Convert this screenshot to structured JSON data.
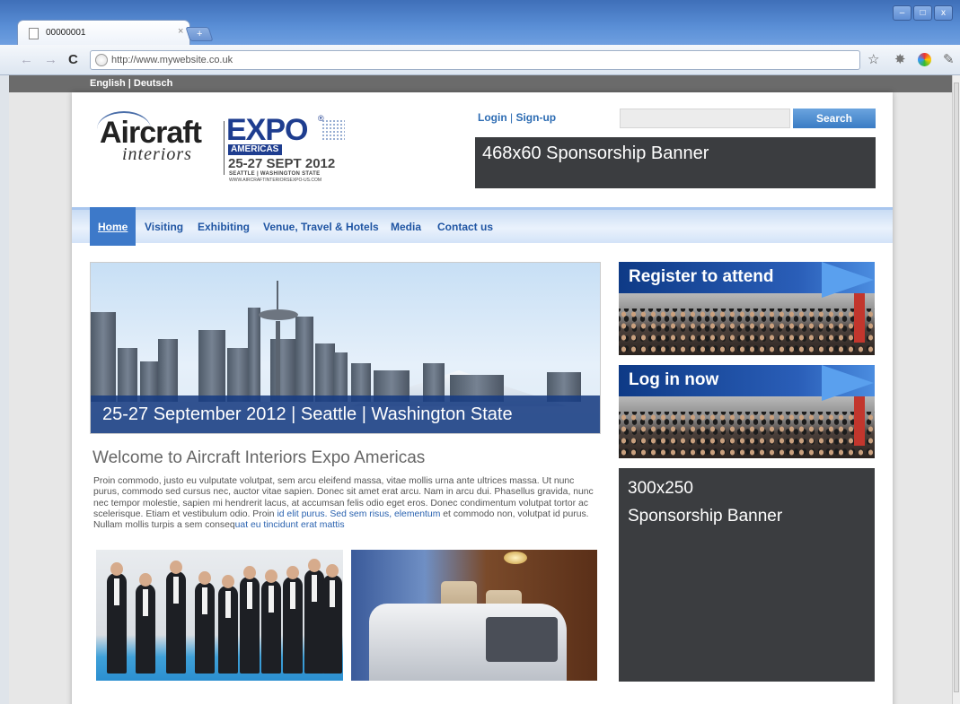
{
  "browser": {
    "tab_title": "00000001",
    "tab_close": "×",
    "new_tab": "+",
    "url": "http://www.mywebsite.co.uk",
    "window_controls": [
      "–",
      "□",
      "x"
    ]
  },
  "lang_bar": "English | Deutsch",
  "logo": {
    "line1": "Aircraft",
    "line2": "interiors",
    "expo": "EXPO",
    "reg_mark": "®",
    "region": "AMERICAS",
    "dates": "25-27 SEPT 2012",
    "location": "SEATTLE | WASHINGTON STATE",
    "website": "WWW.AIRCRAFTINTERIORSEXPO-US.COM"
  },
  "header": {
    "login": "Login",
    "separator": "|",
    "signup": "Sign-up",
    "search_placeholder": "",
    "search_button": "Search",
    "top_banner": "468x60 Sponsorship Banner"
  },
  "nav": {
    "items": [
      "Home",
      "Visiting",
      "Exhibiting",
      "Venue, Travel & Hotels",
      "Media",
      "Contact us"
    ],
    "active": "Home"
  },
  "hero": {
    "caption": "25-27 September 2012 | Seattle | Washington State"
  },
  "welcome": {
    "title": "Welcome to Aircraft Interiors Expo Americas",
    "body_start": "Proin commodo, justo eu vulputate volutpat, sem arcu eleifend massa, vitae mollis urna ante ultrices massa. Ut nunc purus, commodo sed cursus nec, auctor vitae sapien. Donec sit amet erat arcu. Nam in arcu dui. Phasellus gravida, nunc nec tempor molestie, sapien mi hendrerit lacus, at accumsan felis odio eget eros. Donec condimentum volutpat tortor ac scelerisque. Etiam et vestibulum odio. Proin ",
    "body_link1": "id elit purus. Sed sem risus, elementum",
    "body_mid": " et commodo non, volutpat id purus. Nullam mollis turpis a sem conseq",
    "body_link2": "uat eu tincidunt erat mattis"
  },
  "sidebar": {
    "promo1": "Register to attend",
    "promo2": "Log in now",
    "banner_line1": "300x250",
    "banner_line2": "Sponsorship Banner"
  },
  "colors": {
    "nav_active": "#3d79c9",
    "link": "#2d6cb3",
    "banner_bg": "#3b3d40",
    "brand_blue": "#1e3d8f"
  },
  "icons": [
    "page-icon",
    "back-icon",
    "forward-icon",
    "reload-icon",
    "globe-icon",
    "star-icon",
    "extension-icon",
    "chrome-extension-icon",
    "wrench-icon"
  ]
}
